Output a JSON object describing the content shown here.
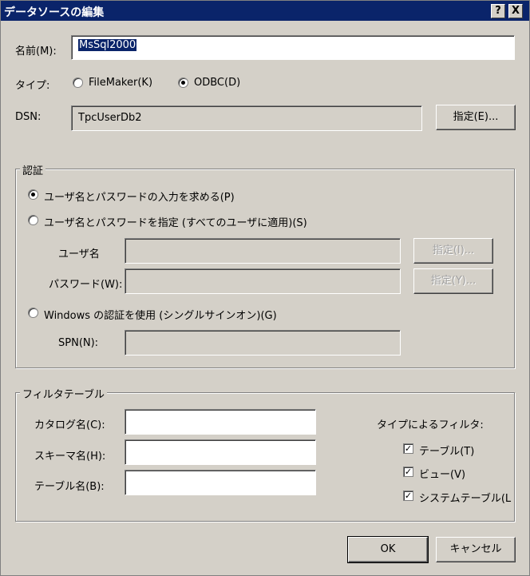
{
  "title": "データソースの編集",
  "titlebar_buttons": {
    "help": "?",
    "close": "X"
  },
  "name_label": "名前(M):",
  "name_value": "MsSql2000",
  "type_label": "タイプ:",
  "type_filemaker": "FileMaker(K)",
  "type_odbc": "ODBC(D)",
  "dsn_label": "DSN:",
  "dsn_value": "TpcUserDb2",
  "dsn_specify_button": "指定(E)...",
  "auth": {
    "group_title": "認証",
    "opt_prompt": "ユーザ名とパスワードの入力を求める(P)",
    "opt_specify": "ユーザ名とパスワードを指定 (すべてのユーザに適用)(S)",
    "user_label": "ユーザ名",
    "user_specify_button": "指定(I)...",
    "password_label": "パスワード(W):",
    "password_specify_button": "指定(Y)...",
    "opt_windows": "Windows の認証を使用 (シングルサインオン)(G)",
    "spn_label": "SPN(N):"
  },
  "filter": {
    "group_title": "フィルタテーブル",
    "catalog_label": "カタログ名(C):",
    "schema_label": "スキーマ名(H):",
    "table_label": "テーブル名(B):",
    "type_filter_label": "タイプによるフィルタ:",
    "chk_table": "テーブル(T)",
    "chk_view": "ビュー(V)",
    "chk_system": "システムテーブル(L",
    "check_mark": "✓"
  },
  "ok_button": "OK",
  "cancel_button": "キャンセル"
}
